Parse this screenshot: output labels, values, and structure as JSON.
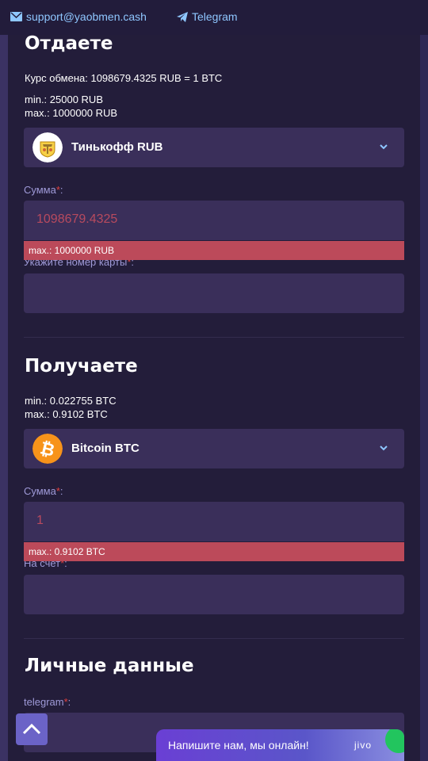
{
  "topbar": {
    "email": "support@yaobmen.cash",
    "telegram": "Telegram"
  },
  "give": {
    "title": "Отдаете",
    "rate": "Курс обмена: 1098679.4325 RUB = 1 BTC",
    "min": "min.: 25000 RUB",
    "max": "max.: 1000000 RUB",
    "currency": "Тинькофф RUB",
    "amount_label": "Сумма",
    "amount_value": "1098679.4325",
    "amount_error": "max.: 1000000 RUB",
    "card_label": "Укажите номер карты",
    "card_value": ""
  },
  "get": {
    "title": "Получаете",
    "min": "min.: 0.022755 BTC",
    "max": "max.: 0.9102 BTC",
    "currency": "Bitcoin BTC",
    "amount_label": "Сумма",
    "amount_value": "1",
    "amount_error": "max.: 0.9102 BTC",
    "account_label": "На счет",
    "account_value": ""
  },
  "personal": {
    "title": "Личные данные",
    "telegram_label": "telegram",
    "telegram_value": ""
  },
  "required_mark": "*",
  "chat": {
    "text": "Напишите нам, мы онлайн!",
    "brand": "jivo"
  },
  "colors": {
    "background": "#231d3a",
    "field": "#3a2f5a",
    "error": "#bc4a5a",
    "accent": "#8fc7ff",
    "label": "#9f9ad8"
  }
}
